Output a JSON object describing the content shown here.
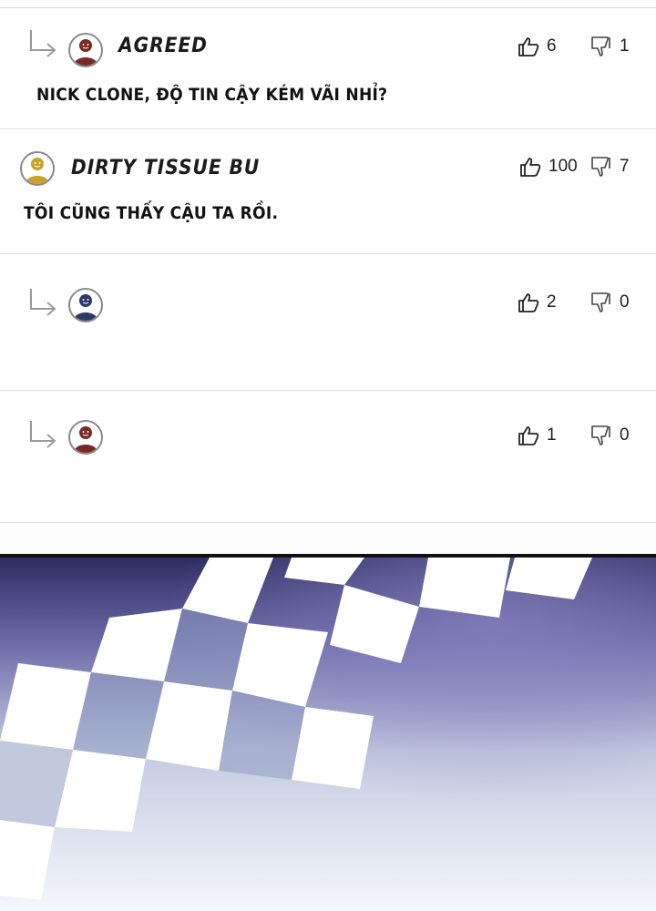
{
  "comments": [
    {
      "username": "AGREED",
      "text": "NICK CLONE, ĐỘ TIN CẬY KÉM VÃI NHỈ?",
      "likes": "6",
      "dislikes": "1",
      "is_reply": true,
      "avatar_color": "#7a2a22"
    },
    {
      "username": "DIRTY TISSUE BU",
      "text": "TÔI CŨNG THẤY CẬU TA RỒI.",
      "likes": "100",
      "dislikes": "7",
      "is_reply": false,
      "avatar_color": "#c9a227"
    },
    {
      "username": "",
      "text": "",
      "likes": "2",
      "dislikes": "0",
      "is_reply": true,
      "avatar_color": "#2c3a66"
    },
    {
      "username": "",
      "text": "",
      "likes": "1",
      "dislikes": "0",
      "is_reply": true,
      "avatar_color": "#7a2a22"
    }
  ],
  "colors": {
    "banner_top": "#2b2a5e",
    "banner_mid": "#6d6aa8",
    "banner_bottom": "#f4f7fb",
    "checker": "#ffffff"
  },
  "icons": {
    "reply": "reply-arrow-icon",
    "like": "thumbs-up-icon",
    "dislike": "thumbs-down-icon",
    "avatar": "user-avatar-icon"
  }
}
